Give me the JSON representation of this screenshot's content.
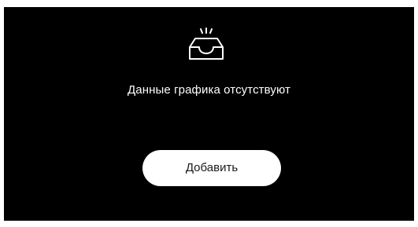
{
  "empty_state": {
    "icon": "empty-tray-icon",
    "message": "Данные графика отсутствуют",
    "add_button_label": "Добавить"
  },
  "colors": {
    "background": "#000000",
    "text": "#ffffff",
    "button_background": "#ffffff",
    "button_text": "#1a1a1a"
  }
}
